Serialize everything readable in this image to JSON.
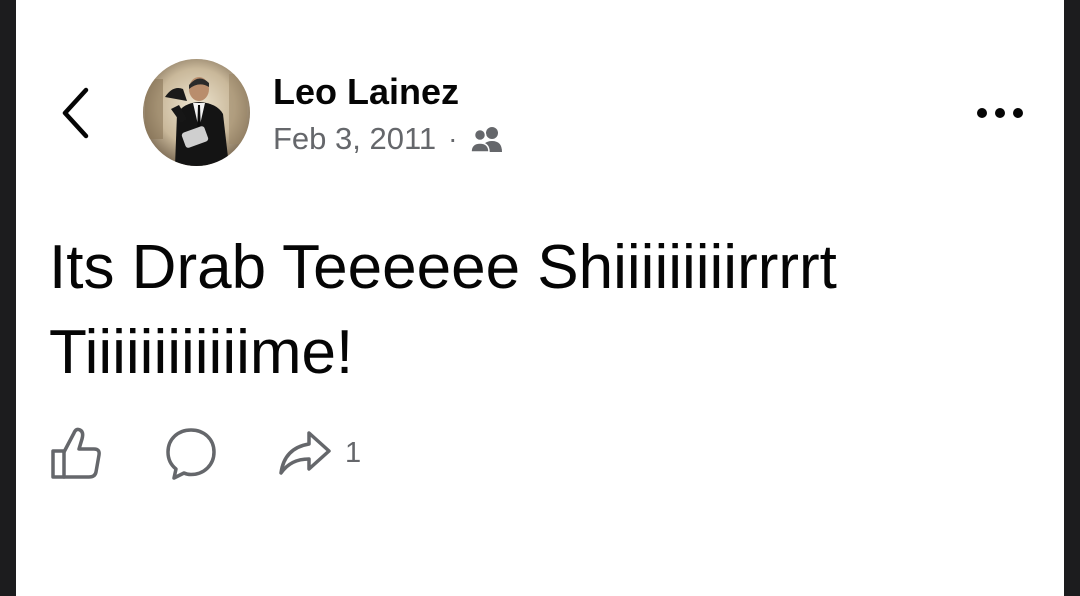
{
  "post": {
    "author": {
      "name": "Leo Lainez"
    },
    "date": "Feb 3, 2011",
    "separator": "·",
    "audience_icon": "friends-icon",
    "text": "Its Drab Teeeeee Shiiiiiiiiirrrrt Tiiiiiiiiiiiime!",
    "actions": {
      "like_icon": "thumbs-up-icon",
      "comment_icon": "comment-bubble-icon",
      "share_icon": "share-arrow-icon",
      "share_count": "1"
    }
  },
  "header": {
    "back_icon": "chevron-left-icon",
    "more_icon": "more-dots-icon"
  },
  "colors": {
    "background": "#ffffff",
    "frame": "#1c1c1e",
    "primary_text": "#050505",
    "secondary_text": "#65676b"
  }
}
